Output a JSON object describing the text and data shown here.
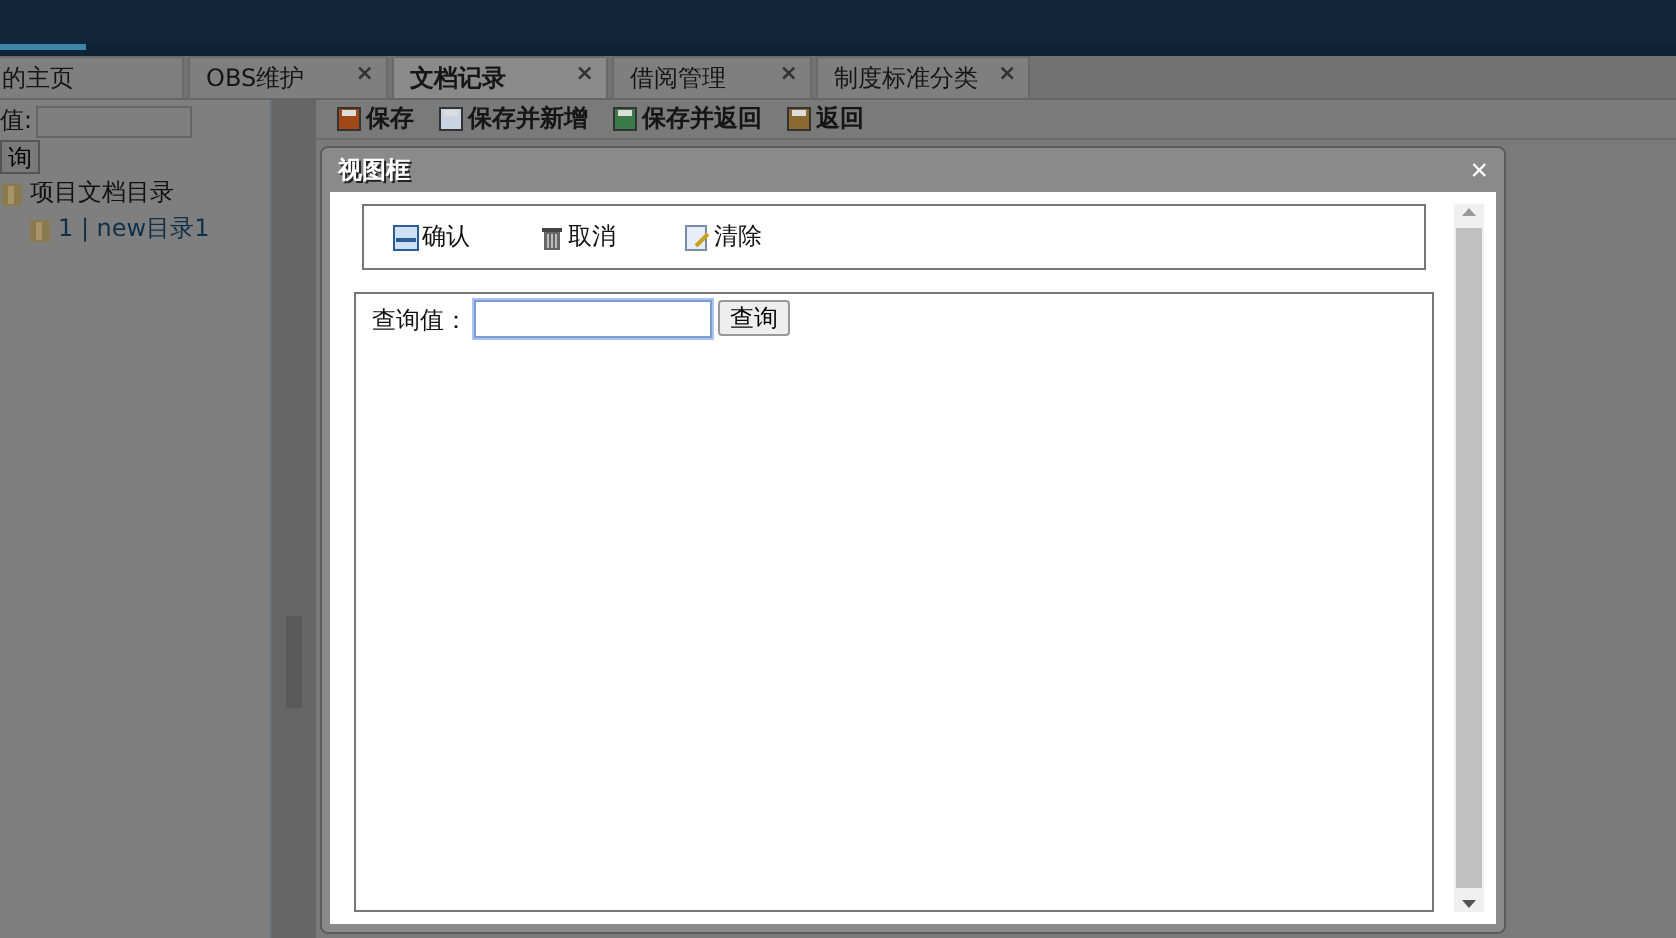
{
  "tabs": [
    {
      "label": "的主页",
      "selected": false
    },
    {
      "label": "OBS维护",
      "selected": false,
      "close": "×"
    },
    {
      "label": "文档记录",
      "selected": true,
      "close": "×"
    },
    {
      "label": "借阅管理",
      "selected": false,
      "close": "×"
    },
    {
      "label": "制度标准分类",
      "selected": false,
      "close": "×"
    }
  ],
  "sidebar": {
    "search_label": "值:",
    "search_button": "询",
    "tree": [
      {
        "label": "项目文档目录",
        "children": [
          {
            "label": "1 | new目录1"
          }
        ]
      }
    ]
  },
  "toolbar": [
    "保存",
    "保存并新增",
    "保存并返回",
    "返回"
  ],
  "dialog": {
    "title": "视图框",
    "close": "×",
    "buttons": [
      {
        "kind": "confirm",
        "label": "确认"
      },
      {
        "kind": "cancel",
        "label": "取消"
      },
      {
        "kind": "clear",
        "label": "清除"
      }
    ],
    "search_label": "查询值：",
    "search_button": "查询"
  }
}
